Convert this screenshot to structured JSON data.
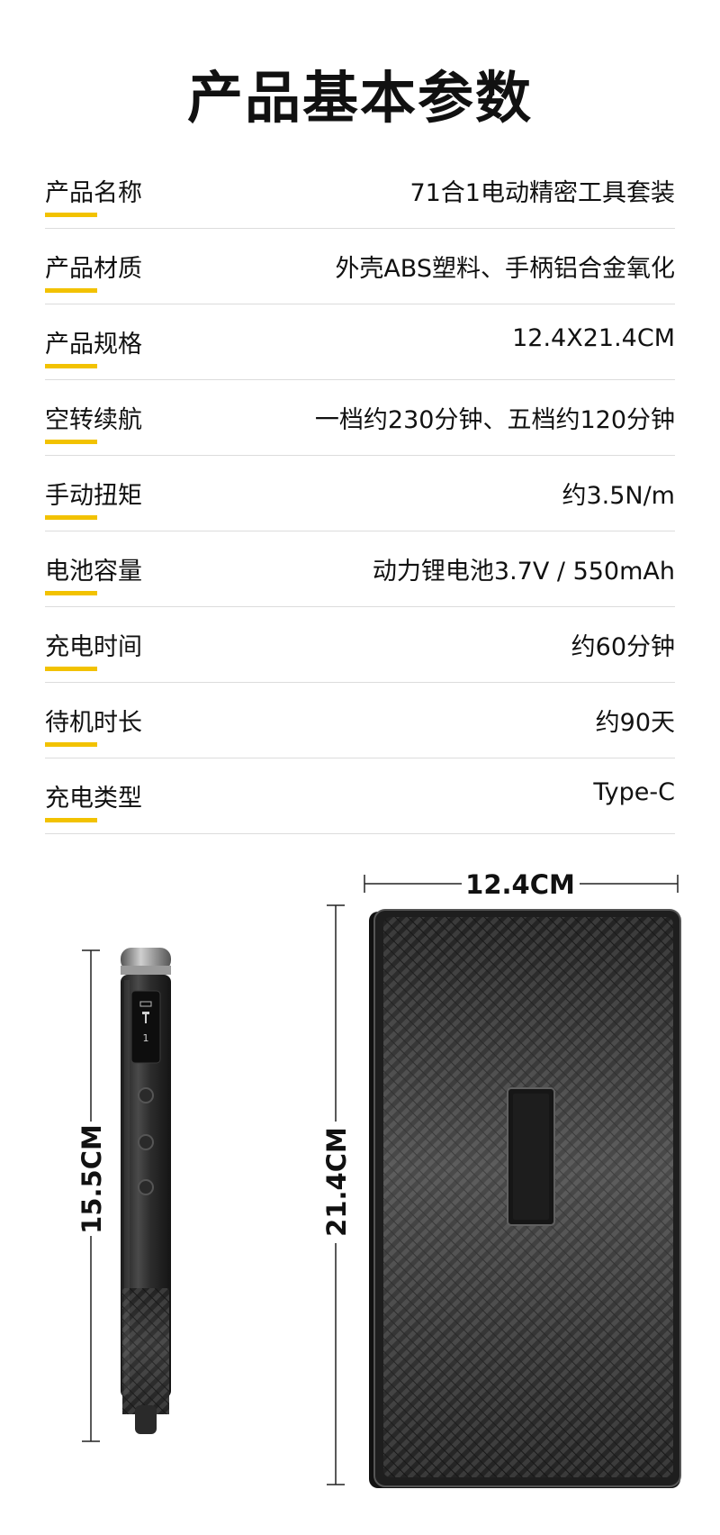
{
  "title": "产品基本参数",
  "specs": [
    {
      "label": "产品名称",
      "value": "71合1电动精密工具套装"
    },
    {
      "label": "产品材质",
      "value": "外壳ABS塑料、手柄铝合金氧化"
    },
    {
      "label": "产品规格",
      "value": "12.4X21.4CM"
    },
    {
      "label": "空转续航",
      "value": "一档约230分钟、五档约120分钟"
    },
    {
      "label": "手动扭矩",
      "value": "约3.5N/m"
    },
    {
      "label": "电池容量",
      "value": "动力锂电池3.7V / 550mAh"
    },
    {
      "label": "充电时间",
      "value": "约60分钟"
    },
    {
      "label": "待机时长",
      "value": "约90天"
    },
    {
      "label": "充电类型",
      "value": "Type-C"
    }
  ],
  "dimensions": {
    "pen_length": "15.5CM",
    "case_width": "12.4CM",
    "case_height": "21.4CM"
  },
  "pen_screen": {
    "level": "1"
  },
  "colors": {
    "accent": "#f2c200",
    "divider": "#dcdcdc",
    "carbon": "#2a2a2a"
  }
}
